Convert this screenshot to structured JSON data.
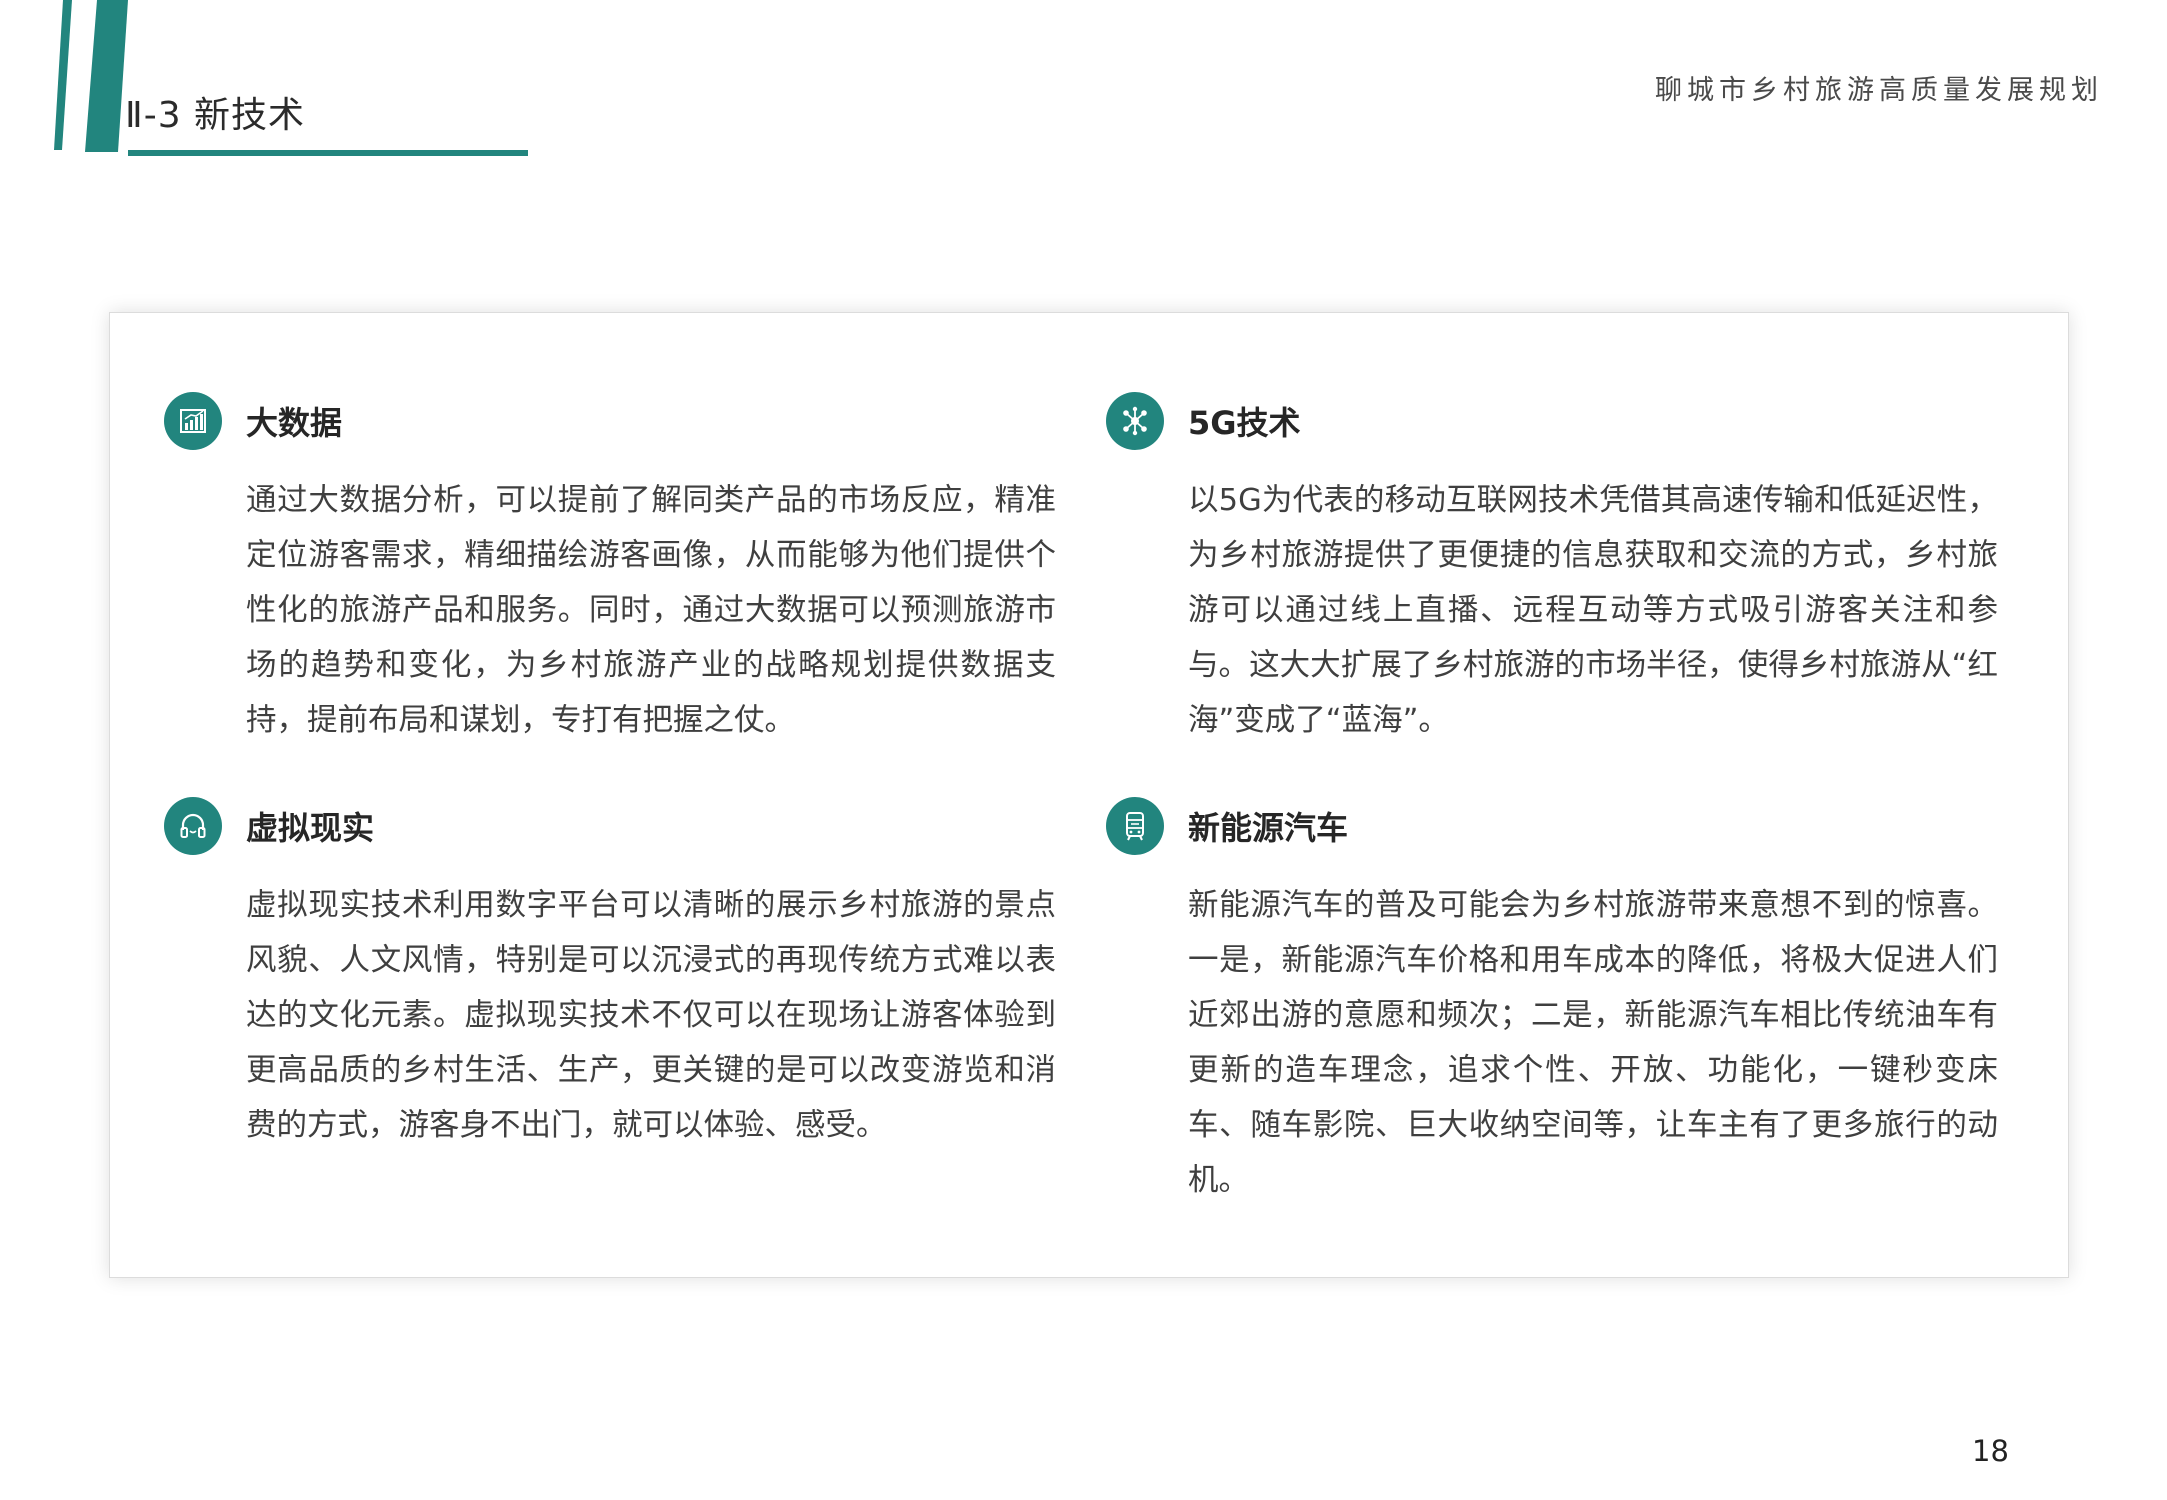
{
  "header": {
    "section_title": "Ⅱ-3 新技术",
    "document_name": "聊城市乡村旅游高质量发展规划",
    "accent_color": "#22857e"
  },
  "items": [
    {
      "icon": "bar-chart-icon",
      "title": "大数据",
      "body": "通过大数据分析，可以提前了解同类产品的市场反应，精准定位游客需求，精细描绘游客画像，从而能够为他们提供个性化的旅游产品和服务。同时，通过大数据可以预测旅游市场的趋势和变化，为乡村旅游产业的战略规划提供数据支持，提前布局和谋划，专打有把握之仗。"
    },
    {
      "icon": "network-icon",
      "title": "5G技术",
      "body": "以5G为代表的移动互联网技术凭借其高速传输和低延迟性，为乡村旅游提供了更便捷的信息获取和交流的方式，乡村旅游可以通过线上直播、远程互动等方式吸引游客关注和参与。这大大扩展了乡村旅游的市场半径，使得乡村旅游从“红海”变成了“蓝海”。"
    },
    {
      "icon": "headphones-icon",
      "title": "虚拟现实",
      "body": "虚拟现实技术利用数字平台可以清晰的展示乡村旅游的景点风貌、人文风情，特别是可以沉浸式的再现传统方式难以表达的文化元素。虚拟现实技术不仅可以在现场让游客体验到更高品质的乡村生活、生产，更关键的是可以改变游览和消费的方式，游客身不出门，就可以体验、感受。"
    },
    {
      "icon": "vehicle-icon",
      "title": "新能源汽车",
      "body": "新能源汽车的普及可能会为乡村旅游带来意想不到的惊喜。一是，新能源汽车价格和用车成本的降低，将极大促进人们近郊出游的意愿和频次；二是，新能源汽车相比传统油车有更新的造车理念，追求个性、开放、功能化，一键秒变床车、随车影院、巨大收纳空间等，让车主有了更多旅行的动机。"
    }
  ],
  "page_number": "18"
}
